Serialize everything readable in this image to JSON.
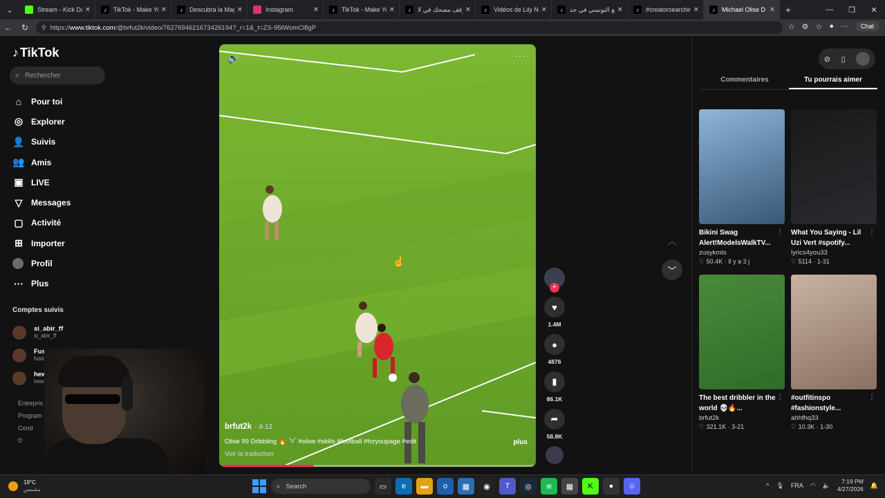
{
  "browser": {
    "tabs": [
      {
        "label": "Stream - Kick Dashb",
        "icon": "kick-icon",
        "color": "#53fc18",
        "active": false
      },
      {
        "label": "TikTok - Make Your D",
        "icon": "tiktok-icon",
        "color": "#000000",
        "active": false
      },
      {
        "label": "Descubra la Magia d",
        "icon": "tiktok-icon",
        "color": "#000000",
        "active": false
      },
      {
        "label": "Instagram",
        "icon": "instagram-icon",
        "color": "#e1306c",
        "active": false
      },
      {
        "label": "TikTok - Make Your D",
        "icon": "tiktok-icon",
        "color": "#000000",
        "active": false
      },
      {
        "label": "موقف مضحك في لا",
        "icon": "tiktok-icon",
        "color": "#000000",
        "active": false
      },
      {
        "label": "Vidéos de Lily Nado",
        "icon": "tiktok-icon",
        "color": "#000000",
        "active": false
      },
      {
        "label": "الواقع التونسي في جد",
        "icon": "tiktok-icon",
        "color": "#000000",
        "active": false
      },
      {
        "label": "#creatorsearchinsigh",
        "icon": "tiktok-icon",
        "color": "#000000",
        "active": false
      },
      {
        "label": "Michael Olise D",
        "icon": "tiktok-icon",
        "color": "#000000",
        "active": true
      }
    ],
    "url_prefix": "https://",
    "url_host": "www.tiktok.com",
    "url_path": "/@brfut2k/video/7627694621673426194?_r=1&_t=ZS-95tWomCl8gP",
    "chat_label": "Chat"
  },
  "sidebar": {
    "logo": "TikTok",
    "search_placeholder": "Rechercher",
    "nav": [
      {
        "label": "Pour toi",
        "icon": "home-icon",
        "glyph": "⌂"
      },
      {
        "label": "Explorer",
        "icon": "compass-icon",
        "glyph": "◎"
      },
      {
        "label": "Suivis",
        "icon": "following-icon",
        "glyph": "👤"
      },
      {
        "label": "Amis",
        "icon": "friends-icon",
        "glyph": "👥"
      },
      {
        "label": "LIVE",
        "icon": "live-icon",
        "glyph": "▣"
      },
      {
        "label": "Messages",
        "icon": "messages-icon",
        "glyph": "▽"
      },
      {
        "label": "Activité",
        "icon": "activity-icon",
        "glyph": "▢"
      },
      {
        "label": "Importer",
        "icon": "upload-icon",
        "glyph": "⊞"
      },
      {
        "label": "Profil",
        "icon": "profile-avatar",
        "glyph": ""
      },
      {
        "label": "Plus",
        "icon": "more-icon",
        "glyph": "···"
      }
    ],
    "following_title": "Comptes suivis",
    "following": [
      {
        "name": "si_abir_ff",
        "user": "si_abir_ff"
      },
      {
        "name": "Fusion",
        "user": "fusion"
      },
      {
        "name": "hew",
        "user": "hew"
      }
    ],
    "footer_links": [
      "Entrepris",
      "Program",
      "Cond",
      "© "
    ]
  },
  "video": {
    "author": "brfut2k",
    "date": "· 4-12",
    "caption": "Olise 99 Dribbling 🔥 ⚔️ #olise #skills #football #foryoupage #edit",
    "more_label": "plus",
    "translate_label": "Voir la traduction",
    "progress": 0.3
  },
  "actions": {
    "likes": "1.4M",
    "comments": "4876",
    "saves": "86.1K",
    "shares": "58.8K"
  },
  "right_panel": {
    "tabs": [
      "Commentaires",
      "Tu pourrais aimer"
    ],
    "active_tab": "Tu pourrais aimer",
    "cards": [
      {
        "title": "Bikini Swag Alert!ModelsWalkTV...",
        "user": "zusykmts",
        "stats": "♡ 50.4K · Il y a 3 j",
        "thumb": "linear-gradient(160deg,#8fb6d6,#6a8fb1 40%,#3a5878)"
      },
      {
        "title": "What You Saying - Lil Uzi Vert #spotify...",
        "user": "lyrics4you33",
        "stats": "♡ 5114 · 1-31",
        "thumb": "linear-gradient(160deg,#1a1a1a,#2a2a30)"
      },
      {
        "title": "The best dribbler in the world 💀🔥...",
        "user": "brfut2k",
        "stats": "♡ 321.1K · 3-21",
        "thumb": "linear-gradient(160deg,#4a8a3a,#2f6b2a)"
      },
      {
        "title": "#outfitinspo #fashionstyle...",
        "user": "ahhfhq33",
        "stats": "♡ 10.3K · 1-30",
        "thumb": "linear-gradient(160deg,#c9b2a3,#8a7062)"
      }
    ]
  },
  "taskbar": {
    "temp": "19°C",
    "weather_text": "مشمس",
    "search_label": "Search",
    "lang": "FRA",
    "time": "7:19 PM",
    "date": "4/27/2026"
  }
}
